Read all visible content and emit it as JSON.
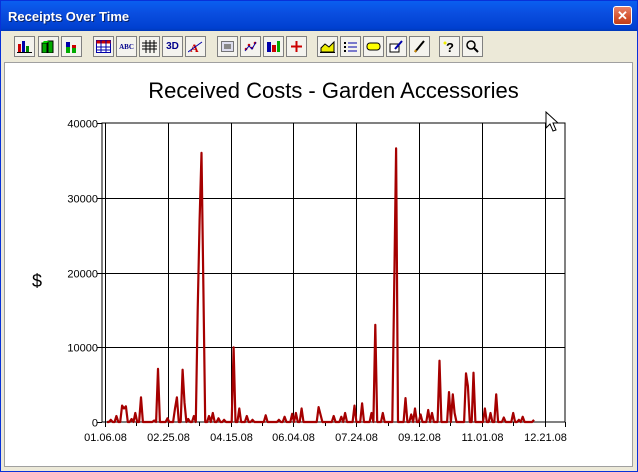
{
  "window": {
    "title": "Receipts Over Time",
    "close_label": "✕"
  },
  "toolbar": {
    "buttons": [
      {
        "name": "bar-chart-icon"
      },
      {
        "name": "3d-bar-icon"
      },
      {
        "name": "stacked-bar-icon"
      },
      {
        "name": "data-grid-icon"
      },
      {
        "name": "text-abc-icon"
      },
      {
        "name": "table-icon"
      },
      {
        "name": "3d-view-icon"
      },
      {
        "name": "axis-font-icon"
      },
      {
        "name": "pattern-icon"
      },
      {
        "name": "scatter-icon"
      },
      {
        "name": "color-icon"
      },
      {
        "name": "crosshair-icon"
      },
      {
        "name": "area-chart-icon"
      },
      {
        "name": "legend-icon"
      },
      {
        "name": "label-icon"
      },
      {
        "name": "edit-icon"
      },
      {
        "name": "pencil-icon"
      },
      {
        "name": "help-icon"
      },
      {
        "name": "zoom-icon"
      }
    ],
    "labels": {
      "text_abc": "ABC",
      "view_3d": "3D"
    }
  },
  "chart_data": {
    "type": "line",
    "title": "Received Costs - Garden Accessories",
    "ylabel": "$",
    "xlabel": "",
    "ylim": [
      0,
      40000
    ],
    "yticks": [
      0,
      10000,
      20000,
      30000,
      40000
    ],
    "xticks": [
      "01.06.08",
      "02.25.08",
      "04.15.08",
      "06.04.08",
      "07.24.08",
      "09.12.08",
      "11.01.08",
      "12.21.08"
    ],
    "grid": true,
    "color": "#a50000",
    "series": [
      {
        "values": [
          0,
          0,
          300,
          0,
          0,
          800,
          0,
          0,
          2200,
          1800,
          2100,
          0,
          0,
          400,
          0,
          1200,
          0,
          0,
          3300,
          0,
          0,
          0,
          0,
          0,
          0,
          200,
          0,
          7100,
          0,
          0,
          0,
          0,
          500,
          0,
          0,
          0,
          1800,
          3300,
          0,
          0,
          7000,
          2600,
          0,
          400,
          0,
          0,
          800,
          0,
          15000,
          27000,
          36000,
          17800,
          0,
          0,
          800,
          0,
          1200,
          0,
          0,
          500,
          0,
          0,
          300,
          0,
          0,
          0,
          0,
          10000,
          0,
          0,
          1800,
          0,
          0,
          0,
          800,
          0,
          0,
          300,
          0,
          0,
          0,
          0,
          0,
          0,
          900,
          0,
          0,
          0,
          0,
          0,
          0,
          300,
          0,
          0,
          700,
          0,
          0,
          0,
          1100,
          0,
          1200,
          0,
          0,
          1800,
          0,
          0,
          0,
          0,
          0,
          0,
          0,
          0,
          2000,
          1000,
          0,
          0,
          0,
          0,
          0,
          0,
          800,
          0,
          0,
          0,
          700,
          0,
          1200,
          0,
          0,
          0,
          0,
          2200,
          0,
          0,
          0,
          2500,
          0,
          0,
          0,
          0,
          1200,
          0,
          13000,
          0,
          0,
          0,
          1200,
          0,
          0,
          0,
          0,
          0,
          18000,
          36600,
          0,
          0,
          0,
          0,
          3200,
          0,
          0,
          1000,
          0,
          1800,
          0,
          0,
          1000,
          0,
          0,
          0,
          1600,
          0,
          1200,
          0,
          0,
          0,
          8200,
          0,
          0,
          0,
          0,
          4000,
          0,
          3700,
          1200,
          0,
          0,
          0,
          0,
          0,
          6500,
          4800,
          0,
          0,
          6600,
          0,
          0,
          0,
          0,
          0,
          1800,
          0,
          0,
          1200,
          0,
          0,
          3700,
          0,
          0,
          0,
          600,
          0,
          0,
          0,
          0,
          1200,
          0,
          0,
          300,
          0,
          700,
          0,
          0,
          0,
          0,
          0,
          300
        ]
      }
    ]
  }
}
